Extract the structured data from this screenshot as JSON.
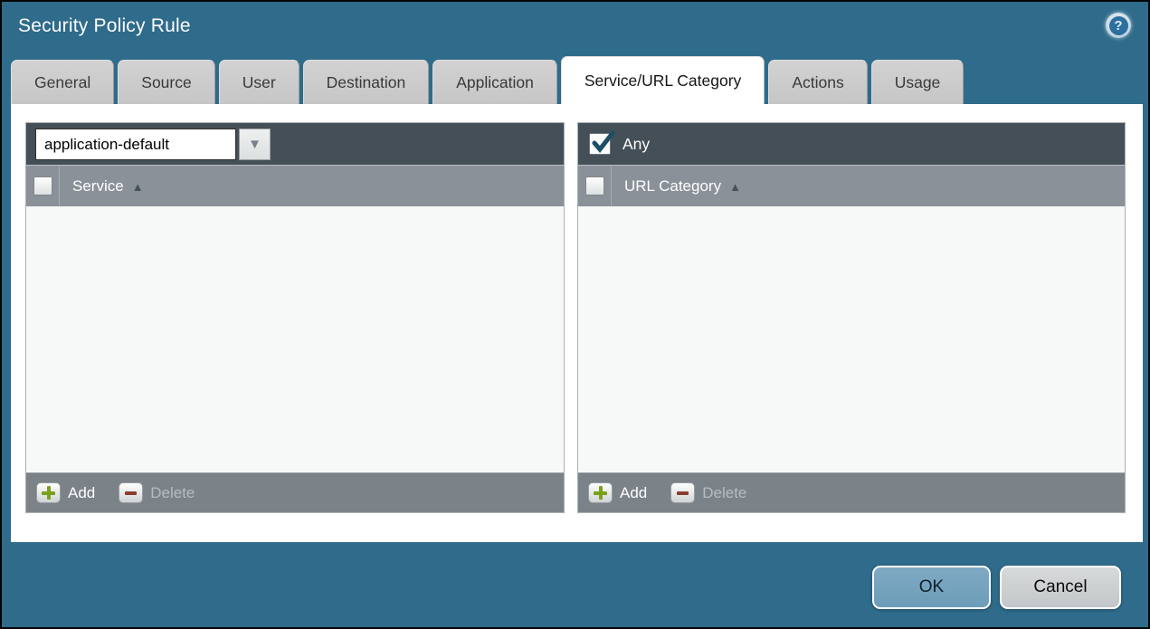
{
  "window": {
    "title": "Security Policy Rule"
  },
  "icons": {
    "help": "?",
    "sort_asc": "▲",
    "dropdown_arrow": "▼"
  },
  "tabs": [
    {
      "label": "General",
      "active": false
    },
    {
      "label": "Source",
      "active": false
    },
    {
      "label": "User",
      "active": false
    },
    {
      "label": "Destination",
      "active": false
    },
    {
      "label": "Application",
      "active": false
    },
    {
      "label": "Service/URL Category",
      "active": true
    },
    {
      "label": "Actions",
      "active": false
    },
    {
      "label": "Usage",
      "active": false
    }
  ],
  "service_panel": {
    "service_dropdown": {
      "value": "application-default"
    },
    "column_header": "Service",
    "rows": [],
    "add_label": "Add",
    "delete_label": "Delete",
    "delete_enabled": false
  },
  "url_category_panel": {
    "any_checkbox": {
      "label": "Any",
      "checked": true
    },
    "column_header": "URL Category",
    "rows": [],
    "add_label": "Add",
    "delete_label": "Delete",
    "delete_enabled": false
  },
  "dialog_buttons": {
    "ok": "OK",
    "cancel": "Cancel"
  },
  "colors": {
    "titlebar_teal": "#2f6b8a",
    "toolbar_dark": "#454f57",
    "header_gray": "#8a9198",
    "footer_gray": "#7b8389",
    "tab_gray": "#c9c9c9",
    "active_tab_white": "#ffffff",
    "ok_button_blue": "#76a4bf",
    "cancel_button_gray": "#cbcfd1",
    "add_plus_green": "#7aa11d",
    "delete_minus_red": "#8a3d2e",
    "checkmark_teal": "#1d4e66"
  }
}
